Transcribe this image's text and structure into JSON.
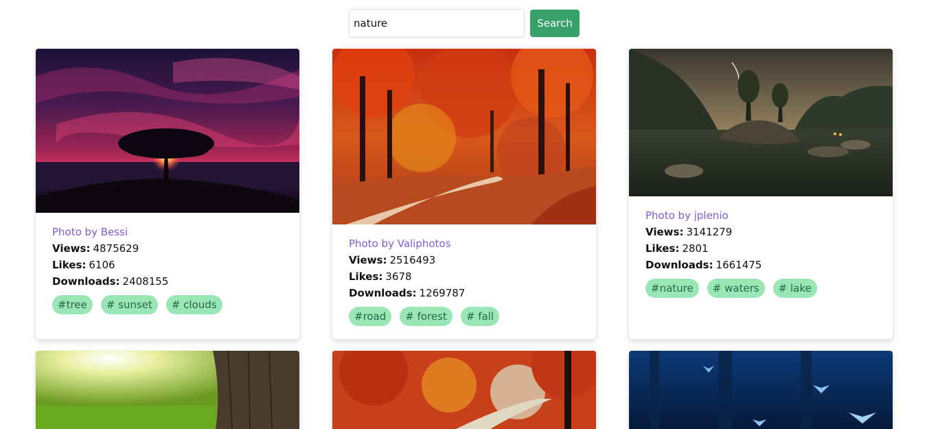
{
  "search": {
    "value": "nature",
    "button_label": "Search"
  },
  "labels": {
    "views": "Views:",
    "likes": "Likes:",
    "downloads": "Downloads:"
  },
  "photos": [
    {
      "author": "Photo by Bessi",
      "views": "4875629",
      "likes": "6106",
      "downloads": "2408155",
      "tags": [
        "#tree",
        "# sunset",
        "# clouds"
      ]
    },
    {
      "author": "Photo by Valiphotos",
      "views": "2516493",
      "likes": "3678",
      "downloads": "1269787",
      "tags": [
        "#road",
        "# forest",
        "# fall"
      ]
    },
    {
      "author": "Photo by jplenio",
      "views": "3141279",
      "likes": "2801",
      "downloads": "1661475",
      "tags": [
        "#nature",
        "# waters",
        "# lake"
      ]
    }
  ],
  "colors": {
    "button": "#38a169",
    "author": "#805ad5",
    "tag_bg": "#9ae6b4",
    "tag_text": "#276749"
  }
}
